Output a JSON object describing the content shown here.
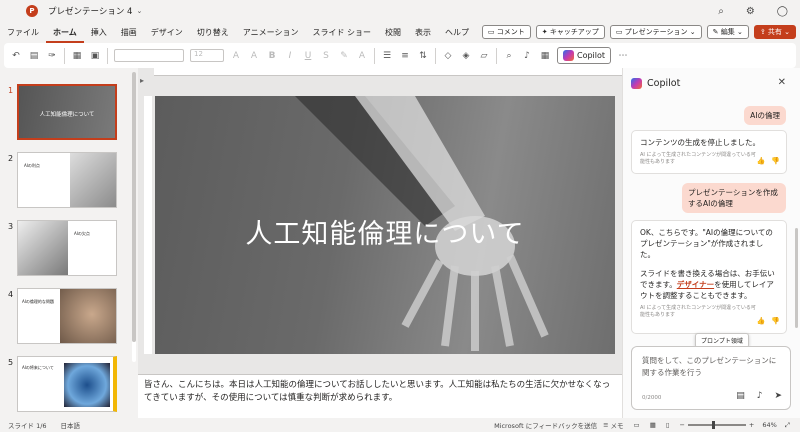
{
  "window": {
    "title": "プレゼンテーション 4"
  },
  "menu": {
    "items": [
      "ファイル",
      "ホーム",
      "挿入",
      "描画",
      "デザイン",
      "切り替え",
      "アニメーション",
      "スライド ショー",
      "校閲",
      "表示",
      "ヘルプ"
    ],
    "comment_label": "コメント",
    "catchup_label": "キャッチアップ",
    "present_label": "プレゼンテーション",
    "edit_label": "編集",
    "share_label": "共有"
  },
  "ribbon": {
    "font_size": "12",
    "copilot_label": "Copilot"
  },
  "thumbnails": [
    {
      "num": "1",
      "title": "人工知能倫理について"
    },
    {
      "num": "2",
      "title": "AIの利点"
    },
    {
      "num": "3",
      "title": "AIの欠点"
    },
    {
      "num": "4",
      "title": "AIの倫理的な問題"
    },
    {
      "num": "5",
      "title": "AIの将来について"
    }
  ],
  "slide": {
    "title": "人工知能倫理について"
  },
  "notes": {
    "text": "皆さん、こんにちは。本日は人工知能の倫理についてお話ししたいと思います。人工知能は私たちの生活に欠かせなくなってきていますが、その使用については慎重な判断が求められます。"
  },
  "copilot": {
    "title": "Copilot",
    "user_msg_1": "AIの倫理",
    "resp_1": "コンテンツの生成を停止しました。",
    "ai_note": "AI によって生成されたコンテンツが間違っている可能性もあります",
    "user_msg_2": "プレゼンテーションを作成するAIの倫理",
    "resp_2_a": "OK、こちらです。\"AIの倫理についてのプレゼンテーション\"が作成されました。",
    "resp_2_b_pre": "スライドを書き換える場合は、お手伝いできます。",
    "resp_2_b_link": "デザイナー",
    "resp_2_b_post": "を使用してレイアウトを調整することもできます。",
    "tooltip": "プロンプト領域",
    "input_placeholder": "質問をして、このプレゼンテーションに関する作業を行う",
    "counter": "0/2000"
  },
  "status": {
    "slide_info": "スライド 1/6",
    "language": "日本語",
    "feedback": "Microsoft にフィードバックを送信",
    "notes_label": "メモ",
    "zoom": "64%"
  },
  "colors": {
    "accent": "#c43e1c",
    "designer_link": "#c43e1c"
  }
}
